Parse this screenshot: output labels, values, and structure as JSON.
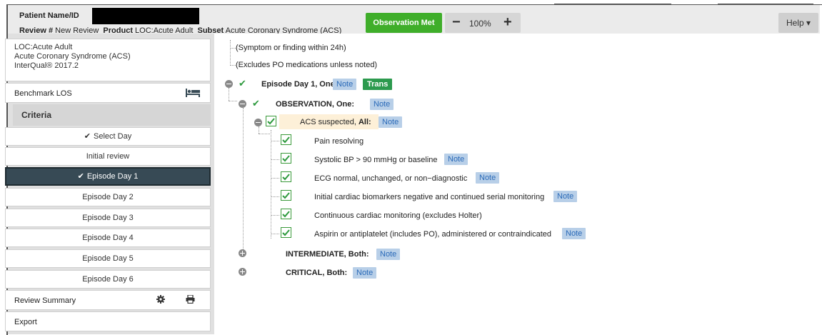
{
  "header": {
    "patient_label": "Patient Name/ID",
    "review_label": "Review #",
    "review_value": "New Review",
    "product_label": "Product",
    "product_value": "LOC:Acute Adult",
    "subset_label": "Subset",
    "subset_value": "Acute Coronary Syndrome (ACS)",
    "observation_button": "Observation Met",
    "zoom_minus": "−",
    "zoom_level": "100%",
    "zoom_plus": "+",
    "help_button": "Help ▾"
  },
  "sidebar": {
    "info_lines": [
      "LOC:Acute Adult",
      "Acute Coronary Syndrome (ACS)",
      "InterQual® 2017.2"
    ],
    "benchmark_label": "Benchmark LOS",
    "criteria_label": "Criteria",
    "days": [
      {
        "label": "Select Day",
        "checked": true,
        "active": false
      },
      {
        "label": "Initial review",
        "checked": false,
        "active": false
      },
      {
        "label": "Episode Day 1",
        "checked": true,
        "active": true
      },
      {
        "label": "Episode Day 2",
        "checked": false,
        "active": false
      },
      {
        "label": "Episode Day 3",
        "checked": false,
        "active": false
      },
      {
        "label": "Episode Day 4",
        "checked": false,
        "active": false
      },
      {
        "label": "Episode Day 5",
        "checked": false,
        "active": false
      },
      {
        "label": "Episode Day 6",
        "checked": false,
        "active": false
      }
    ],
    "review_summary_label": "Review Summary",
    "export_label": "Export"
  },
  "tree": {
    "note_text": "Note",
    "trans_text": "Trans",
    "info1": "(Symptom or finding within 24h)",
    "info2": "(Excludes PO medications unless noted)",
    "episode": "Episode Day 1, One:",
    "observation": "OBSERVATION, One:",
    "acs_prefix": "ACS suspected,",
    "acs_all": "All:",
    "criteria": [
      {
        "text": "Pain resolving",
        "note": false
      },
      {
        "text": "Systolic BP > 90 mmHg or baseline",
        "note": true
      },
      {
        "text": "ECG normal, unchanged, or non−diagnostic",
        "note": true
      },
      {
        "text": "Initial cardiac biomarkers negative and continued serial monitoring",
        "note": true
      },
      {
        "text": "Continuous cardiac monitoring (excludes Holter)",
        "note": false
      },
      {
        "text": "Aspirin or antiplatelet (includes PO), administered or contraindicated",
        "note": true
      }
    ],
    "intermediate": "INTERMEDIATE, Both:",
    "critical": "CRITICAL, Both:"
  },
  "colors": {
    "observation_green": "#3fae2a",
    "active_day": "#374a55",
    "note_bg": "#b8cfe8",
    "trans_green": "#2c9a4e"
  }
}
